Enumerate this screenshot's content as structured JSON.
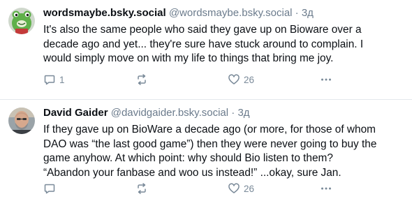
{
  "posts": [
    {
      "display_name": "wordsmaybe.bsky.social",
      "handle": "@wordsmaybe.bsky.social",
      "separator": "·",
      "time": "3д",
      "text": "It's also the same people who said they gave up on Bioware over a\ndecade ago and yet... they're sure have stuck around to complain. I\nwould simply move on with my life to things that bring me joy.",
      "reply_count": "1",
      "repost_count": "",
      "like_count": "26"
    },
    {
      "display_name": "David Gaider",
      "handle": "@davidgaider.bsky.social",
      "separator": "·",
      "time": "3д",
      "text": "If they gave up on BioWare a decade ago (or more, for those of whom\nDAO was “the last good game”) then they were never going to buy the\ngame anyhow. At which point: why should Bio listen to them?\n“Abandon your fanbase and woo us instead!” ...okay, sure Jan.",
      "reply_count": "",
      "repost_count": "",
      "like_count": "26"
    }
  ],
  "icons": {
    "reply": "speech-bubble-icon",
    "repost": "repost-arrows-icon",
    "like": "heart-icon",
    "more": "more-dots-icon",
    "avatar1": "green-frog-avatar",
    "avatar2": "bald-bearded-man-avatar"
  },
  "colors": {
    "muted": "#6b7b8c",
    "icon": "#7a8a99",
    "text": "#0b0f14",
    "divider": "#e3e8ec"
  }
}
